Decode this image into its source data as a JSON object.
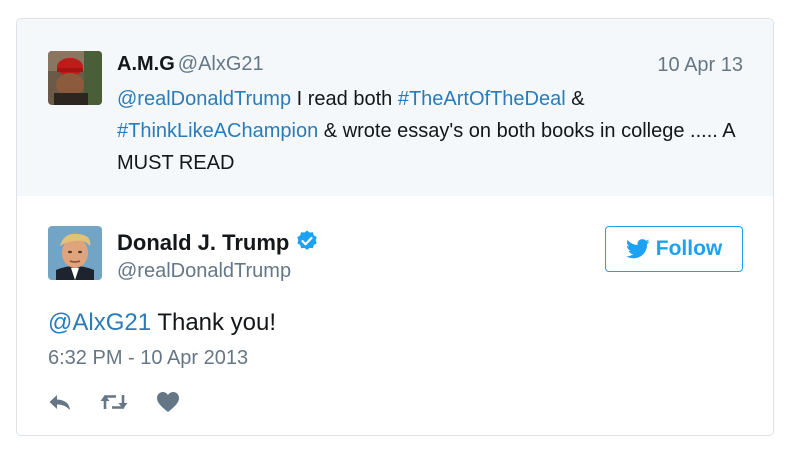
{
  "colors": {
    "link": "#2b7bb9",
    "twitter_blue": "#1da1f2",
    "secondary_text": "#657786",
    "parent_bg": "#f5f8fa",
    "border": "#dde3e8"
  },
  "parent_tweet": {
    "name": "A.M.G",
    "handle": "@AlxG21",
    "date": "10 Apr 13",
    "text": {
      "mention": "@realDonaldTrump",
      "part1": " I read both ",
      "hashtag1": "#TheArtOfTheDeal",
      "part2": " & ",
      "hashtag2": "#ThinkLikeAChampion",
      "part3": " & wrote essay's on both books in college ..... A MUST READ"
    }
  },
  "main_tweet": {
    "name": "Donald J. Trump",
    "handle": "@realDonaldTrump",
    "verified_icon": "verified-badge-icon",
    "follow_label": "Follow",
    "text": {
      "mention": "@AlxG21",
      "body": " Thank you!"
    },
    "timestamp": "6:32 PM - 10 Apr 2013",
    "actions": [
      "reply-icon",
      "retweet-icon",
      "like-icon"
    ]
  }
}
